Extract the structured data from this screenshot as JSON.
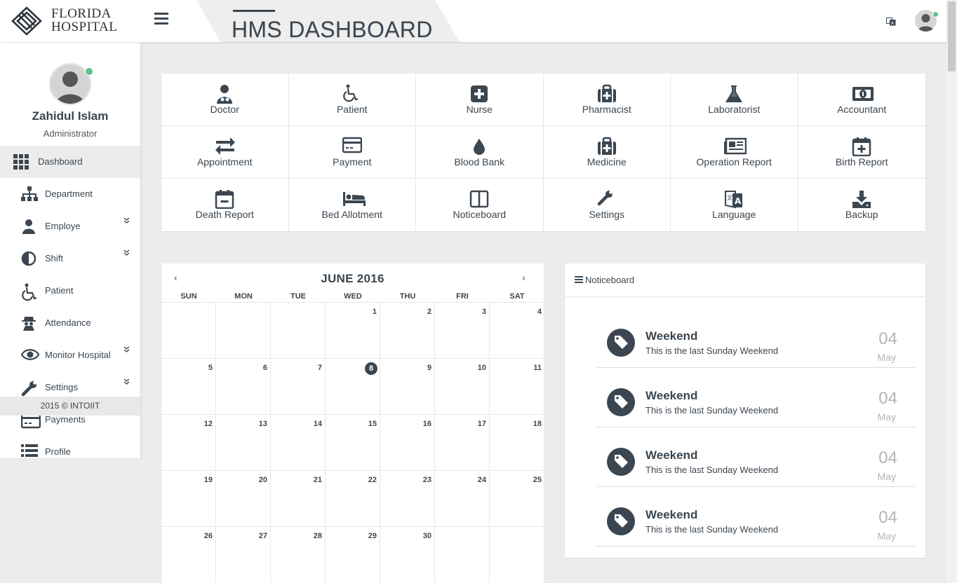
{
  "brand": {
    "line1": "FLORIDA",
    "line2": "HOSPITAL"
  },
  "header": {
    "title": "HMS DASHBOARD"
  },
  "user": {
    "name": "Zahidul Islam",
    "role": "Administrator"
  },
  "sidebar": {
    "items": [
      {
        "label": "Dashboard",
        "icon": "grid-icon",
        "active": true
      },
      {
        "label": "Department",
        "icon": "sitemap-icon"
      },
      {
        "label": "Employe",
        "icon": "user-icon",
        "expandable": true
      },
      {
        "label": "Shift",
        "icon": "contrast-icon",
        "expandable": true
      },
      {
        "label": "Patient",
        "icon": "wheelchair-icon"
      },
      {
        "label": "Attendance",
        "icon": "spy-icon"
      },
      {
        "label": "Monitor Hospital",
        "icon": "eye-icon",
        "expandable": true
      },
      {
        "label": "Settings",
        "icon": "wrench-icon",
        "expandable": true
      },
      {
        "label": "Payments",
        "icon": "credit-card-icon"
      },
      {
        "label": "Profile",
        "icon": "list-icon"
      }
    ],
    "footer": "2015 © INTOIIT"
  },
  "shortcuts": [
    {
      "label": "Doctor",
      "icon": "doctor-icon"
    },
    {
      "label": "Patient",
      "icon": "wheelchair-icon"
    },
    {
      "label": "Nurse",
      "icon": "plus-square-icon"
    },
    {
      "label": "Pharmacist",
      "icon": "medkit-icon"
    },
    {
      "label": "Laboratorist",
      "icon": "flask-icon"
    },
    {
      "label": "Accountant",
      "icon": "money-icon"
    },
    {
      "label": "Appointment",
      "icon": "exchange-icon"
    },
    {
      "label": "Payment",
      "icon": "credit-card-icon"
    },
    {
      "label": "Blood Bank",
      "icon": "tint-icon"
    },
    {
      "label": "Medicine",
      "icon": "medkit-icon"
    },
    {
      "label": "Operation Report",
      "icon": "newspaper-icon"
    },
    {
      "label": "Birth Report",
      "icon": "calendar-plus-icon"
    },
    {
      "label": "Death Report",
      "icon": "calendar-minus-icon"
    },
    {
      "label": "Bed Allotment",
      "icon": "bed-icon"
    },
    {
      "label": "Noticeboard",
      "icon": "columns-icon"
    },
    {
      "label": "Settings",
      "icon": "wrench-icon"
    },
    {
      "label": "Language",
      "icon": "language-icon"
    },
    {
      "label": "Backup",
      "icon": "download-icon"
    }
  ],
  "calendar": {
    "title": "JUNE 2016",
    "prev": "‹",
    "next": "›",
    "days_of_week": [
      "SUN",
      "MON",
      "TUE",
      "WED",
      "THU",
      "FRI",
      "SAT"
    ],
    "first_weekday": 3,
    "days_in_month": 30,
    "today": 8,
    "weeks": 5
  },
  "noticeboard": {
    "title": "Noticeboard",
    "notices": [
      {
        "title": "Weekend",
        "desc": "This is the last Sunday Weekend",
        "day": "04",
        "month": "May"
      },
      {
        "title": "Weekend",
        "desc": "This is the last Sunday Weekend",
        "day": "04",
        "month": "May"
      },
      {
        "title": "Weekend",
        "desc": "This is the last Sunday Weekend",
        "day": "04",
        "month": "May"
      },
      {
        "title": "Weekend",
        "desc": "This is the last Sunday Weekend",
        "day": "04",
        "month": "May"
      }
    ]
  },
  "colors": {
    "primary": "#3b4650",
    "online": "#5cc38a",
    "background": "#ececec"
  }
}
